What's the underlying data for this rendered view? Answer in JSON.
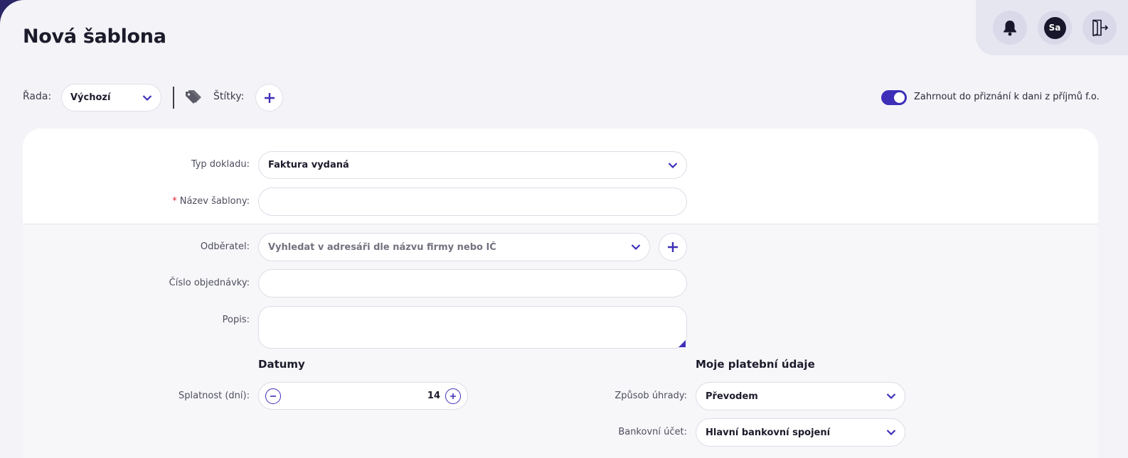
{
  "page": {
    "title": "Nová šablona"
  },
  "topbar": {
    "notifications_icon": "bell-icon",
    "avatar_initials": "Sa",
    "logout_icon": "exit-door-icon"
  },
  "toolbar": {
    "rada_label": "Řada:",
    "rada_value": "Výchozí",
    "stitky_label": "Štítky:",
    "tag_icon": "tags-icon",
    "toggle_on": true,
    "toggle_label": "Zahrnout do přiznání k dani z příjmů f.o."
  },
  "form": {
    "typ_dokladu": {
      "label": "Typ dokladu:",
      "value": "Faktura vydaná"
    },
    "nazev_sablony": {
      "required_mark": "*",
      "label": "Název šablony:",
      "value": ""
    },
    "odberatel": {
      "label": "Odběratel:",
      "placeholder": "Vyhledat v adresáři dle názvu firmy nebo IČ"
    },
    "cislo_objednavky": {
      "label": "Číslo objednávky:",
      "value": ""
    },
    "popis": {
      "label": "Popis:",
      "value": ""
    }
  },
  "datumy": {
    "heading": "Datumy",
    "splatnost_label": "Splatnost (dní):",
    "splatnost_value": "14"
  },
  "platebni": {
    "heading": "Moje platební údaje",
    "zpusob_label": "Způsob úhrady:",
    "zpusob_value": "Převodem",
    "ucet_label": "Bankovní účet:",
    "ucet_value": "Hlavní bankovní spojení"
  },
  "colors": {
    "accent": "#3d2fb8",
    "frame": "#2b2668",
    "background": "#f4f4f8"
  }
}
